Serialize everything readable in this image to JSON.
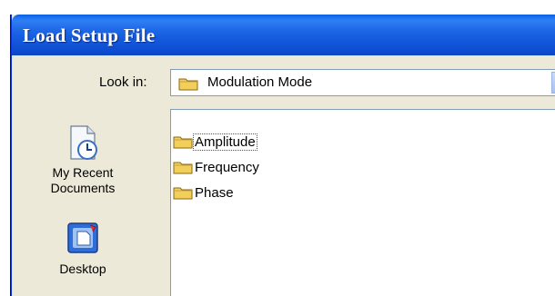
{
  "window": {
    "title": "Load Setup File"
  },
  "toolbar": {
    "look_in_label": "Look in:",
    "look_in_value": "Modulation Mode",
    "look_in_icon": "folder-icon"
  },
  "places": [
    {
      "label": "My Recent Documents",
      "icon": "recent-documents-icon"
    },
    {
      "label": "Desktop",
      "icon": "desktop-icon"
    }
  ],
  "files": [
    {
      "name": "Amplitude",
      "icon": "folder-icon",
      "focused": true
    },
    {
      "name": "Frequency",
      "icon": "folder-icon",
      "focused": false
    },
    {
      "name": "Phase",
      "icon": "folder-icon",
      "focused": false
    }
  ],
  "colors": {
    "titlebar": "#1d66e6",
    "dialog_bg": "#ece9d8",
    "folder": "#f2cf5b"
  }
}
